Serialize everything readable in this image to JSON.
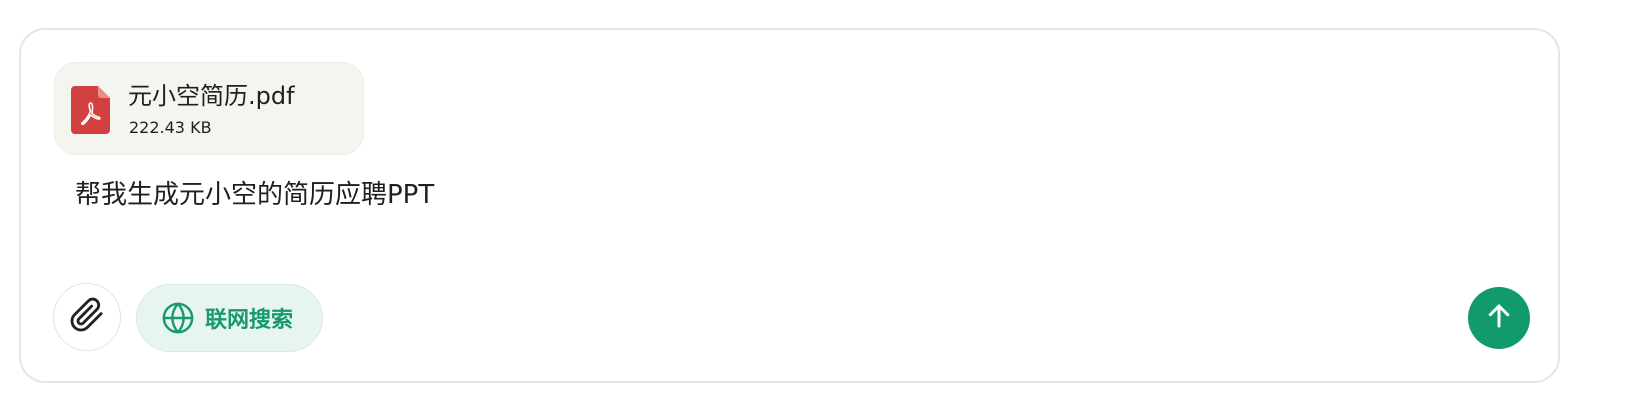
{
  "attachment": {
    "file_name": "元小空简历.pdf",
    "file_size": "222.43 KB",
    "icon": "pdf-file-icon"
  },
  "composer": {
    "message": "帮我生成元小空的简历应聘PPT"
  },
  "toolbar": {
    "attach_icon": "paperclip-icon",
    "web_search_label": "联网搜索",
    "web_search_icon": "globe-icon",
    "send_icon": "arrow-up-icon"
  },
  "colors": {
    "accent": "#119a6b",
    "web_search_text": "#179a6c",
    "web_search_bg": "#e8f4ef",
    "pdf_red": "#d24040",
    "attachment_bg": "#f5f5f0",
    "border": "#e6e5df"
  }
}
